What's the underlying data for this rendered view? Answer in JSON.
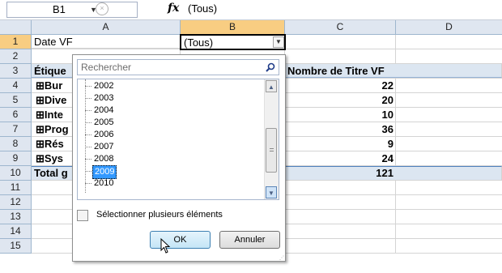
{
  "formula_bar": {
    "cell_ref": "B1",
    "cancel_symbol": "×",
    "fx_label": "fx",
    "value": "(Tous)"
  },
  "columns": [
    "A",
    "B",
    "C",
    "D"
  ],
  "rows": [
    "1",
    "2",
    "3",
    "4",
    "5",
    "6",
    "7",
    "8",
    "9",
    "10",
    "11",
    "12",
    "13",
    "14",
    "15"
  ],
  "cells": {
    "a1": "Date VF",
    "b1": "(Tous)",
    "a3": "Étique",
    "c3": "Nombre de Titre VF",
    "a4": "⊞Bur",
    "a5": "⊞Dive",
    "a6": "⊞Inte",
    "a7": "⊞Prog",
    "a8": "⊞Rés",
    "a9": "⊞Sys",
    "a10": "Total g",
    "c4": "22",
    "c5": "20",
    "c6": "10",
    "c7": "36",
    "c8": "9",
    "c9": "24",
    "c10": "121"
  },
  "filter_popup": {
    "search_placeholder": "Rechercher",
    "items": [
      "2002",
      "2003",
      "2004",
      "2005",
      "2006",
      "2007",
      "2008",
      "2009",
      "2010"
    ],
    "selected_item": "2009",
    "multi_select_label": "Sélectionner plusieurs éléments",
    "ok_label": "OK",
    "cancel_label": "Annuler"
  },
  "colors": {
    "header_bg": "#dfe6f0",
    "selected_header": "#f8cd82",
    "pivot_header": "#dce6f1",
    "selection_blue": "#3399ff"
  }
}
